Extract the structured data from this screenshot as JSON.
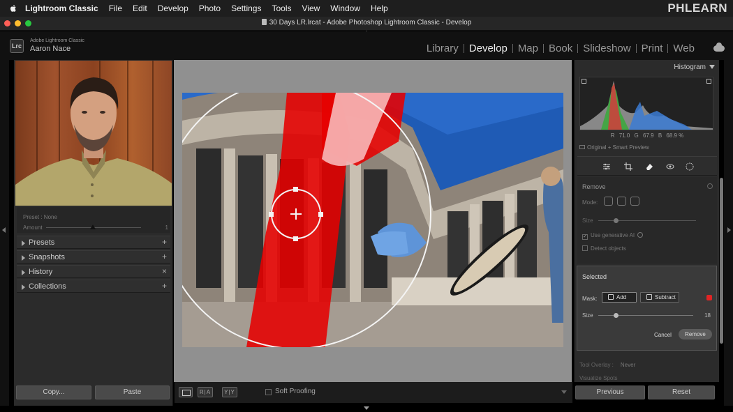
{
  "menubar": {
    "app": "Lightroom Classic",
    "items": [
      "File",
      "Edit",
      "Develop",
      "Photo",
      "Settings",
      "Tools",
      "View",
      "Window",
      "Help"
    ],
    "brand": "PHLEARN"
  },
  "window": {
    "title": "30 Days LR.lrcat - Adobe Photoshop Lightroom Classic - Develop"
  },
  "identity": {
    "logo": "Lrc",
    "app_name": "Adobe Lightroom Classic",
    "user_name": "Aaron Nace"
  },
  "modules": [
    "Library",
    "Develop",
    "Map",
    "Book",
    "Slideshow",
    "Print",
    "Web"
  ],
  "active_module": "Develop",
  "left_panel": {
    "preset_label": "Preset : None",
    "amount_label": "Amount",
    "amount_value": "1",
    "sections": [
      {
        "label": "Presets",
        "action": "+"
      },
      {
        "label": "Snapshots",
        "action": "+"
      },
      {
        "label": "History",
        "action": "×"
      },
      {
        "label": "Collections",
        "action": "+"
      }
    ],
    "copy_label": "Copy...",
    "paste_label": "Paste"
  },
  "toolbar": {
    "compare_ab": "R|A",
    "compare_yy": "Y|Y",
    "soft_proofing": "Soft Proofing"
  },
  "histogram": {
    "title": "Histogram",
    "r_label": "R",
    "r_value": "71.0",
    "g_label": "G",
    "g_value": "67.9",
    "b_label": "B",
    "b_value": "68.9 %",
    "original_label": "Original + Smart Preview"
  },
  "remove_panel": {
    "title": "Remove",
    "mode_label": "Mode:",
    "size_label": "Size",
    "generative_label": "Use generative AI",
    "detect_label": "Detect objects"
  },
  "selected_panel": {
    "title": "Selected",
    "mask_label": "Mask:",
    "add_label": "Add",
    "subtract_label": "Subtract",
    "size_label": "Size",
    "size_value": "18",
    "size_fraction": 0.18,
    "cancel_label": "Cancel",
    "remove_label": "Remove"
  },
  "tool_overlay": {
    "label": "Tool Overlay :",
    "value": "Never",
    "visualize_label": "Visualize Spots"
  },
  "bottom_right": {
    "previous_label": "Previous",
    "reset_label": "Reset"
  },
  "colors": {
    "accent": "#e02424",
    "panel": "#2b2b2b"
  }
}
